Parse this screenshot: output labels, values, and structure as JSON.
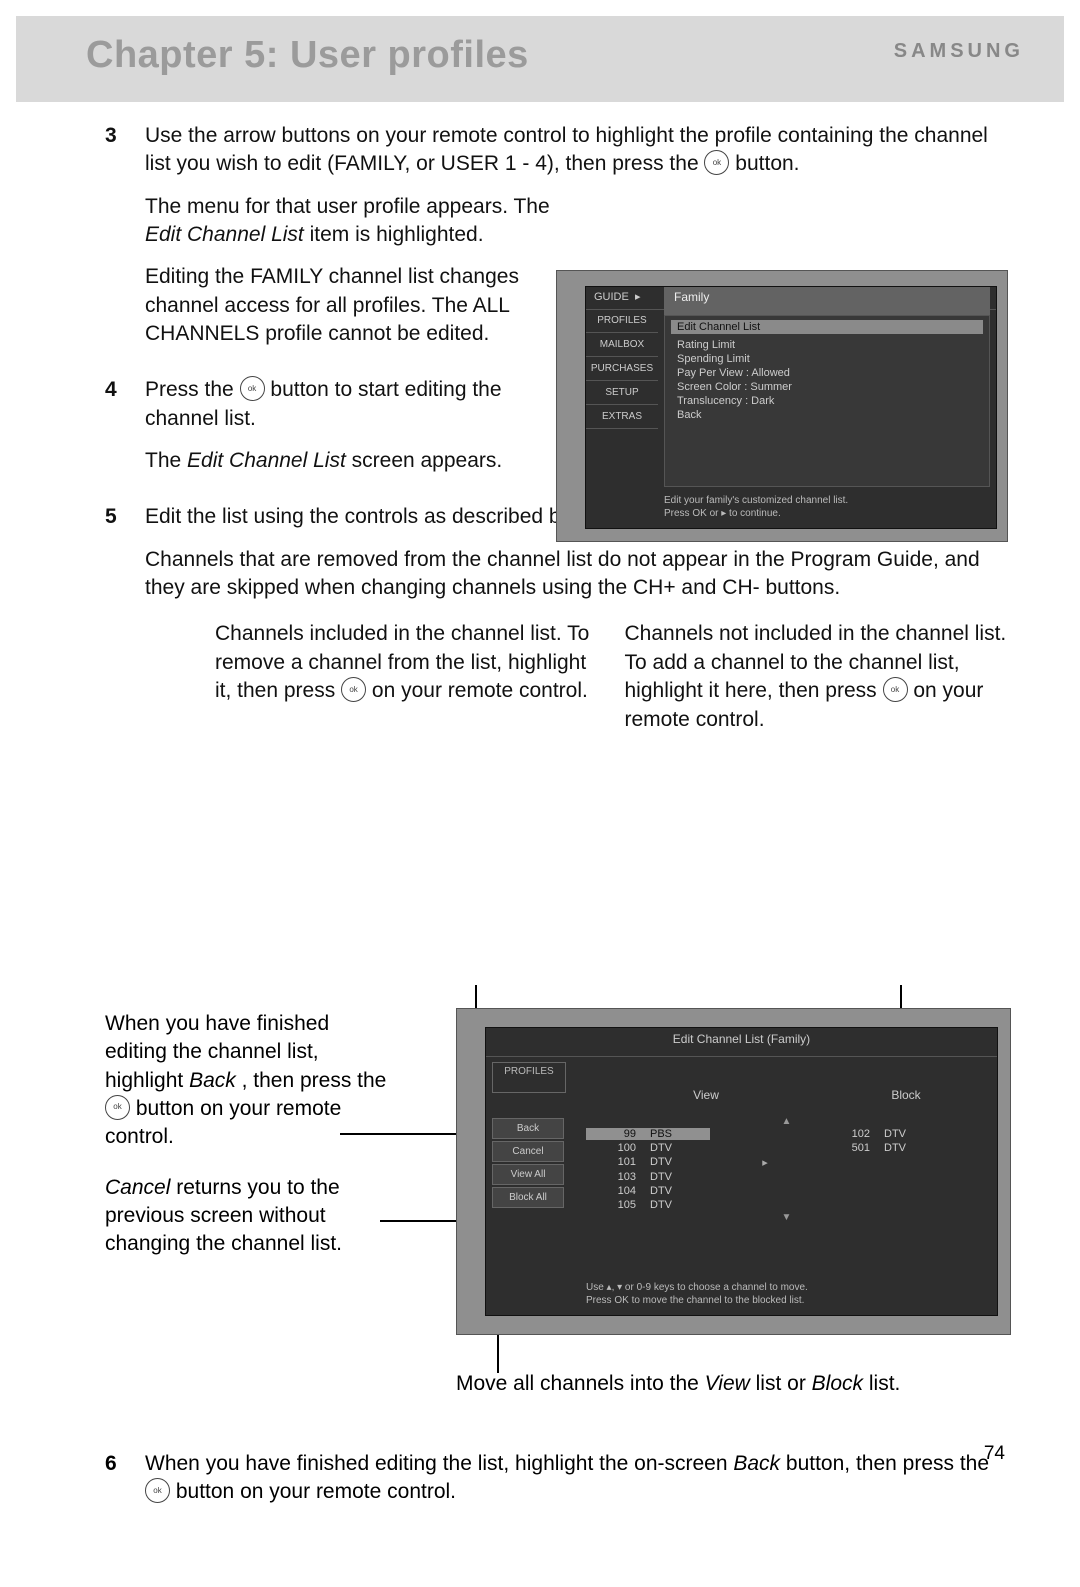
{
  "header": {
    "chapter_title": "Chapter 5: User profiles",
    "brand": "SAMSUNG"
  },
  "steps": {
    "s3": {
      "num": "3",
      "p1a": "Use the arrow buttons on your remote control to highlight the profile containing the channel list you wish to edit (FAMILY, or USER 1 - 4), then press the ",
      "p1b": " button.",
      "p2a": "The menu for that user profile appears. The ",
      "p2_it": "Edit Channel List",
      "p2b": " item is highlighted.",
      "p3": "Editing the FAMILY channel list changes channel access for all profiles. The ALL CHANNELS profile cannot be edited."
    },
    "s4": {
      "num": "4",
      "p1a": "Press the ",
      "p1b": " button to start editing the channel list.",
      "p2a": "The ",
      "p2_it": "Edit Channel List",
      "p2b": " screen appears."
    },
    "s5": {
      "num": "5",
      "p1": "Edit the list using the controls as described below.",
      "p2": "Channels that are removed from the channel list do not appear in the Program Guide, and they are skipped when changing channels using the CH+ and CH- buttons."
    },
    "s6": {
      "num": "6",
      "p1a": "When you have finished editing the list, highlight the on-screen ",
      "p1_it": "Back",
      "p1b": " button, then press the ",
      "p1c": " button on your remote control."
    }
  },
  "callouts": {
    "inc_a": "Channels included in the channel list. To remove a channel from the list, highlight it, then press ",
    "inc_b": " on your remote control.",
    "not_a": "Channels not included in the channel list. To add a channel to the channel list, highlight it here, then press ",
    "not_b": " on your remote control.",
    "fin_a": "When you have finished editing the channel list, highlight ",
    "fin_it": "Back",
    "fin_b": ", then press the ",
    "fin_c": " button on your remote control.",
    "cancel_a": "Cancel",
    "cancel_b": " returns you to the previous screen without changing the channel list.",
    "move_a": "Move all channels into the ",
    "move_it1": "View",
    "move_b": " list or ",
    "move_it2": "Block",
    "move_c": " list."
  },
  "shot1": {
    "left_items": [
      "GUIDE",
      "PROFILES",
      "MAILBOX",
      "PURCHASES",
      "SETUP",
      "EXTRAS"
    ],
    "header": "Family",
    "right_items": [
      "Edit Channel List",
      "Rating Limit",
      "Spending Limit",
      "Pay Per View : Allowed",
      "Screen Color : Summer",
      "Translucency : Dark",
      "Back"
    ],
    "bot1": "Edit your family's customized channel list.",
    "bot2": "Press OK or ▸ to continue."
  },
  "shot2": {
    "title": "Edit Channel List (Family)",
    "profiles": "PROFILES",
    "side": [
      "Back",
      "Cancel",
      "View All",
      "Block All"
    ],
    "view_hdr": "View",
    "block_hdr": "Block",
    "view_list": [
      {
        "n": "99",
        "l": "PBS"
      },
      {
        "n": "100",
        "l": "DTV"
      },
      {
        "n": "101",
        "l": "DTV"
      },
      {
        "n": "103",
        "l": "DTV"
      },
      {
        "n": "104",
        "l": "DTV"
      },
      {
        "n": "105",
        "l": "DTV"
      }
    ],
    "block_list": [
      {
        "n": "102",
        "l": "DTV"
      },
      {
        "n": "501",
        "l": "DTV"
      }
    ],
    "bot1": "Use ▴, ▾ or 0-9 keys to choose a channel to move.",
    "bot2": "Press OK to move the channel to the blocked list."
  },
  "page_number": "74"
}
